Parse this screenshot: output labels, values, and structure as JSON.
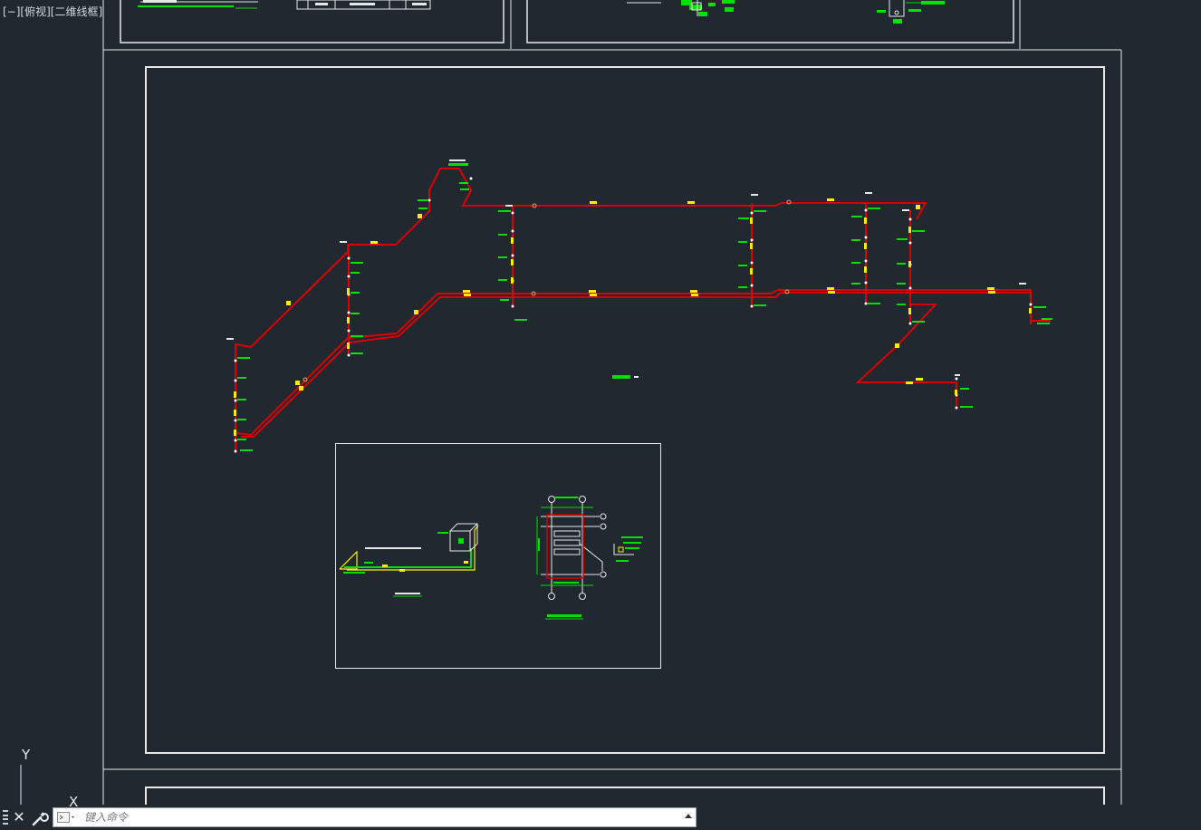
{
  "viewport": {
    "label": "[−][俯视][二维线框]"
  },
  "ucs": {
    "y_label": "Y",
    "x_label": "X"
  },
  "command_line": {
    "placeholder": "键入命令"
  },
  "colors": {
    "background": "#212830",
    "frame": "#ffffff",
    "pipe": "#d80000",
    "annotation": "#00e000",
    "marker": "#ffee00"
  },
  "icons": [
    "grip-icon",
    "close-icon",
    "wrench-icon",
    "command-prompt-icon",
    "chevron-up-icon"
  ]
}
